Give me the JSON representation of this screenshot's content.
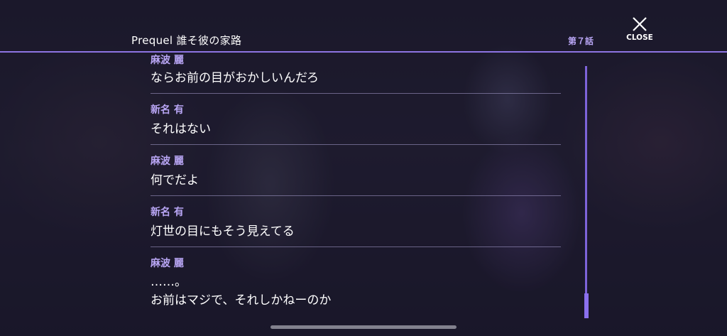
{
  "header": {
    "title": "Prequel 誰そ彼の家路",
    "chapter": "第７話",
    "close_label": "CLOSE"
  },
  "log": [
    {
      "speaker": "麻波 麗",
      "lines": [
        "ならお前の目がおかしいんだろ"
      ]
    },
    {
      "speaker": "新名 有",
      "lines": [
        "それはない"
      ]
    },
    {
      "speaker": "麻波 麗",
      "lines": [
        "何でだよ"
      ]
    },
    {
      "speaker": "新名 有",
      "lines": [
        "灯世の目にもそう見えてる"
      ]
    },
    {
      "speaker": "麻波 麗",
      "lines": [
        "……。",
        "お前はマジで、それしかねーのか"
      ]
    }
  ],
  "colors": {
    "accent": "#8d74e3",
    "speaker": "#b9a6f5",
    "text": "#ffffff"
  },
  "icons": {
    "close": "close-icon"
  }
}
